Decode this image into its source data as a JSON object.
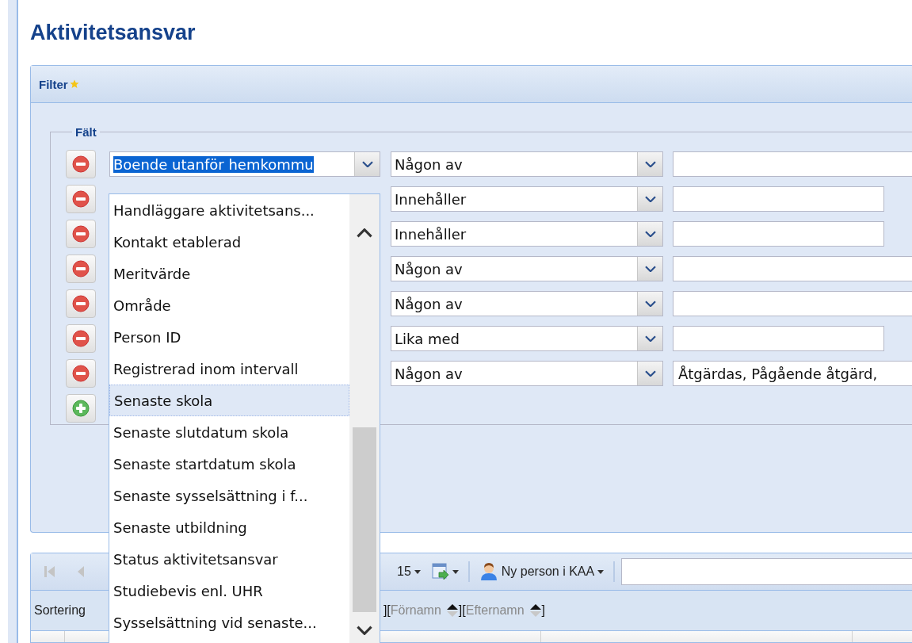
{
  "page_title": "Aktivitetsansvar",
  "filter": {
    "title": "Filter",
    "fieldset_legend": "Fält",
    "first_field": {
      "value": "Boende utanför hemkommu",
      "text_selected": true
    },
    "rows": [
      {
        "operator": "Någon av",
        "kind": "wide"
      },
      {
        "operator": "Innehåller",
        "kind": "short"
      },
      {
        "operator": "Innehåller",
        "kind": "short"
      },
      {
        "operator": "Någon av",
        "kind": "wide"
      },
      {
        "operator": "Någon av",
        "kind": "wide"
      },
      {
        "operator": "Lika med",
        "kind": "short"
      },
      {
        "operator": "Någon av",
        "kind": "wide",
        "value": "Åtgärdas, Pågående åtgärd,"
      }
    ]
  },
  "field_dropdown": {
    "items": [
      {
        "label": "Handläggare aktivitetsans...",
        "selected": false
      },
      {
        "label": "Kontakt etablerad",
        "selected": false
      },
      {
        "label": "Meritvärde",
        "selected": false
      },
      {
        "label": "Område",
        "selected": false
      },
      {
        "label": "Person ID",
        "selected": false
      },
      {
        "label": "Registrerad inom intervall",
        "selected": false
      },
      {
        "label": "Senaste skola",
        "selected": true
      },
      {
        "label": "Senaste slutdatum skola",
        "selected": false
      },
      {
        "label": "Senaste startdatum skola",
        "selected": false
      },
      {
        "label": "Senaste sysselsättning i f...",
        "selected": false
      },
      {
        "label": "Senaste utbildning",
        "selected": false
      },
      {
        "label": "Status aktivitetsansvar",
        "selected": false
      },
      {
        "label": "Studiebevis enl. UHR",
        "selected": false
      },
      {
        "label": "Sysselsättning vid senaste...",
        "selected": false
      }
    ]
  },
  "toolbar": {
    "page_size": "15",
    "new_person": "Ny person i KAA"
  },
  "sort_bar": {
    "label": "Sortering",
    "parts": [
      {
        "kind": "text",
        "text": "]["
      },
      {
        "kind": "field",
        "text": "Förnamn"
      },
      {
        "kind": "text",
        "text": "]["
      },
      {
        "kind": "field",
        "text": "Efternamn"
      },
      {
        "kind": "text",
        "text": "]"
      }
    ]
  }
}
